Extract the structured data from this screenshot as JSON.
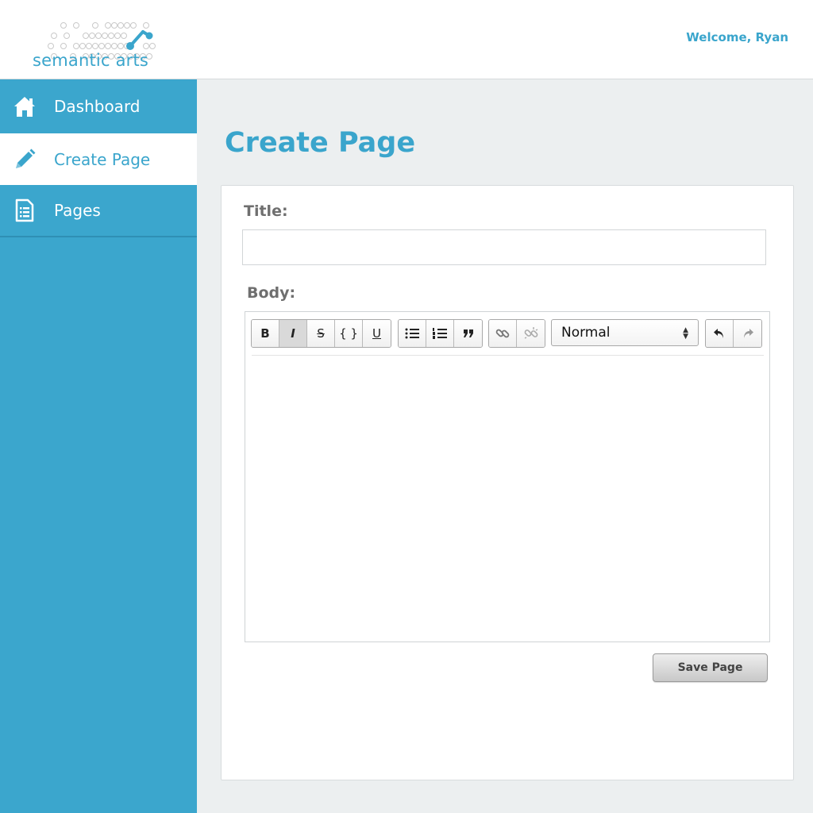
{
  "brand": {
    "name": "semantic arts"
  },
  "header": {
    "welcome": "Welcome, Ryan"
  },
  "sidebar": {
    "items": [
      {
        "label": "Dashboard",
        "icon": "home-icon",
        "active": false
      },
      {
        "label": "Create Page",
        "icon": "pencil-icon",
        "active": true
      },
      {
        "label": "Pages",
        "icon": "document-icon",
        "active": false
      }
    ]
  },
  "main": {
    "title": "Create Page",
    "form": {
      "title_label": "Title:",
      "title_value": "",
      "body_label": "Body:",
      "editor": {
        "toolbar": {
          "format_buttons": [
            "B",
            "I",
            "S",
            "{ }",
            "U"
          ],
          "active_button": "I",
          "list_buttons": [
            "bullet-list-icon",
            "numbered-list-icon",
            "blockquote-icon"
          ],
          "link_buttons": [
            "link-icon",
            "unlink-icon"
          ],
          "heading_select": "Normal",
          "history_buttons": [
            "undo-icon",
            "redo-icon"
          ]
        },
        "content": ""
      },
      "save_label": "Save Page"
    }
  },
  "colors": {
    "accent": "#3ba6cd",
    "background": "#eceff0",
    "text_muted": "#6f6f6f"
  }
}
